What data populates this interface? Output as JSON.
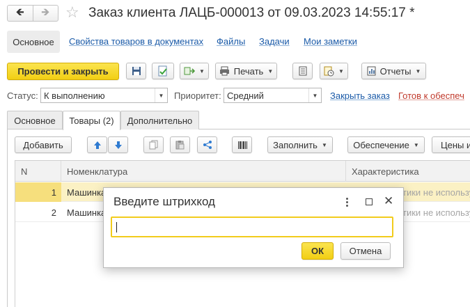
{
  "window": {
    "title": "Заказ клиента ЛАЦБ-000013 от 09.03.2023 14:55:17 *"
  },
  "nav_links": {
    "main": "Основное",
    "links": [
      "Свойства товаров в документах",
      "Файлы",
      "Задачи",
      "Мои заметки"
    ]
  },
  "toolbar": {
    "post_close": "Провести и закрыть",
    "print": "Печать",
    "reports": "Отчеты"
  },
  "status_row": {
    "status_label": "Статус:",
    "status_value": "К выполнению",
    "priority_label": "Приоритет:",
    "priority_value": "Средний",
    "close_order": "Закрыть заказ",
    "ready_link": "Готов к обеспеч"
  },
  "tabs": [
    "Основное",
    "Товары (2)",
    "Дополнительно"
  ],
  "goods_toolbar": {
    "add": "Добавить",
    "fill": "Заполнить",
    "supply": "Обеспечение",
    "prices": "Цены и"
  },
  "table": {
    "headers": [
      "N",
      "Номенклатура",
      "Характеристика"
    ],
    "rows": [
      {
        "n": "1",
        "name": "Машинка",
        "char": "тики не использу"
      },
      {
        "n": "2",
        "name": "Машинка",
        "char": "тики не использу"
      }
    ]
  },
  "dialog": {
    "title": "Введите штрихкод",
    "input_value": "",
    "ok": "ОК",
    "cancel": "Отмена"
  },
  "colors": {
    "accent_yellow": "#f5d21e",
    "link_blue": "#1a5aa8",
    "link_red": "#c0392b",
    "row_selected": "#fbf1c4"
  }
}
